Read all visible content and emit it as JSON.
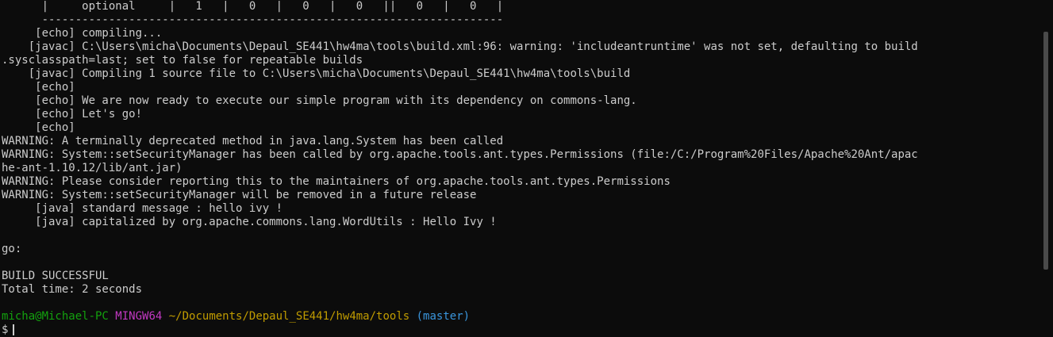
{
  "terminal": {
    "lines": [
      "      |     optional     |   1   |   0   |   0   |   0   ||   0   |   0   |",
      "      ---------------------------------------------------------------------",
      "     [echo] compiling...",
      "    [javac] C:\\Users\\micha\\Documents\\Depaul_SE441\\hw4ma\\tools\\build.xml:96: warning: 'includeantruntime' was not set, defaulting to build",
      ".sysclasspath=last; set to false for repeatable builds",
      "    [javac] Compiling 1 source file to C:\\Users\\micha\\Documents\\Depaul_SE441\\hw4ma\\tools\\build",
      "     [echo]",
      "     [echo] We are now ready to execute our simple program with its dependency on commons-lang.",
      "     [echo] Let's go!",
      "     [echo]",
      "WARNING: A terminally deprecated method in java.lang.System has been called",
      "WARNING: System::setSecurityManager has been called by org.apache.tools.ant.types.Permissions (file:/C:/Program%20Files/Apache%20Ant/apac",
      "he-ant-1.10.12/lib/ant.jar)",
      "WARNING: Please consider reporting this to the maintainers of org.apache.tools.ant.types.Permissions",
      "WARNING: System::setSecurityManager will be removed in a future release",
      "     [java] standard message : hello ivy !",
      "     [java] capitalized by org.apache.commons.lang.WordUtils : Hello Ivy !",
      "",
      "go:",
      "",
      "BUILD SUCCESSFUL",
      "Total time: 2 seconds",
      ""
    ],
    "prompt": {
      "user_host": "micha@Michael-PC",
      "system": "MINGW64",
      "path": "~/Documents/Depaul_SE441/hw4ma/tools",
      "branch": "(master)",
      "symbol": "$"
    },
    "colors": {
      "background": "#0c0c0c",
      "foreground": "#cccccc",
      "user_host": "#13a10e",
      "system": "#c239c2",
      "path": "#c19c00",
      "branch": "#3a96dd"
    }
  }
}
